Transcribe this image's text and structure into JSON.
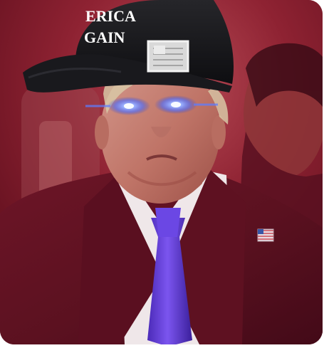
{
  "image": {
    "kind": "photo-edit",
    "tint_color": "#7b1526",
    "shirt_color": "#efe7e9",
    "skin_color": "#c98579",
    "tie_color": "#6a3fd6",
    "eye_glow_color": "#4f7dff",
    "cap_color": "#17171a"
  },
  "cap": {
    "text_line_1": "ERICA",
    "text_line_2": "GAIN"
  },
  "icons": {
    "flag_patch": "american-flag-patch-icon",
    "lapel_pin": "american-flag-lapel-pin-icon"
  }
}
